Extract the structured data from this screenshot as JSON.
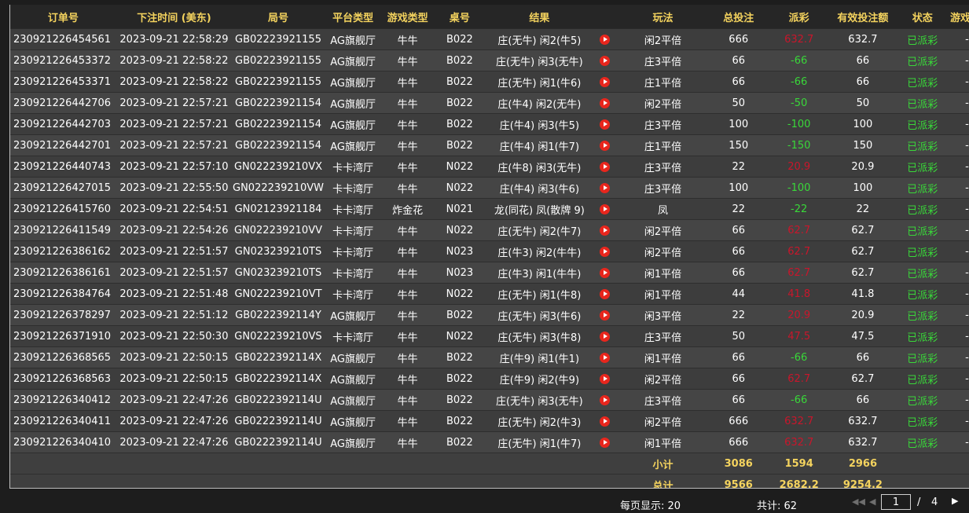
{
  "columns": [
    "订单号",
    "下注时间 (美东)",
    "局号",
    "平台类型",
    "游戏类型",
    "桌号",
    "结果",
    "",
    "玩法",
    "总投注",
    "派彩",
    "有效投注额",
    "状态",
    "游戏模式"
  ],
  "rows": [
    {
      "order": "230921226454561",
      "time": "2023-09-21 22:58:29",
      "round": "GB02223921155",
      "platform": "AG旗舰厅",
      "game": "牛牛",
      "table": "B022",
      "result": "庄(无牛) 闲2(牛5)",
      "play": "闲2平倍",
      "bet": "666",
      "payout": "632.7",
      "payout_type": "pos",
      "valid": "632.7",
      "status": "已派彩",
      "mode": "-"
    },
    {
      "order": "230921226453372",
      "time": "2023-09-21 22:58:22",
      "round": "GB02223921155",
      "platform": "AG旗舰厅",
      "game": "牛牛",
      "table": "B022",
      "result": "庄(无牛) 闲3(无牛)",
      "play": "庄3平倍",
      "bet": "66",
      "payout": "-66",
      "payout_type": "neg",
      "valid": "66",
      "status": "已派彩",
      "mode": "-"
    },
    {
      "order": "230921226453371",
      "time": "2023-09-21 22:58:22",
      "round": "GB02223921155",
      "platform": "AG旗舰厅",
      "game": "牛牛",
      "table": "B022",
      "result": "庄(无牛) 闲1(牛6)",
      "play": "庄1平倍",
      "bet": "66",
      "payout": "-66",
      "payout_type": "neg",
      "valid": "66",
      "status": "已派彩",
      "mode": "-"
    },
    {
      "order": "230921226442706",
      "time": "2023-09-21 22:57:21",
      "round": "GB02223921154",
      "platform": "AG旗舰厅",
      "game": "牛牛",
      "table": "B022",
      "result": "庄(牛4) 闲2(无牛)",
      "play": "闲2平倍",
      "bet": "50",
      "payout": "-50",
      "payout_type": "neg",
      "valid": "50",
      "status": "已派彩",
      "mode": "-"
    },
    {
      "order": "230921226442703",
      "time": "2023-09-21 22:57:21",
      "round": "GB02223921154",
      "platform": "AG旗舰厅",
      "game": "牛牛",
      "table": "B022",
      "result": "庄(牛4) 闲3(牛5)",
      "play": "庄3平倍",
      "bet": "100",
      "payout": "-100",
      "payout_type": "neg",
      "valid": "100",
      "status": "已派彩",
      "mode": "-"
    },
    {
      "order": "230921226442701",
      "time": "2023-09-21 22:57:21",
      "round": "GB02223921154",
      "platform": "AG旗舰厅",
      "game": "牛牛",
      "table": "B022",
      "result": "庄(牛4) 闲1(牛7)",
      "play": "庄1平倍",
      "bet": "150",
      "payout": "-150",
      "payout_type": "neg",
      "valid": "150",
      "status": "已派彩",
      "mode": "-"
    },
    {
      "order": "230921226440743",
      "time": "2023-09-21 22:57:10",
      "round": "GN022239210VX",
      "platform": "卡卡湾厅",
      "game": "牛牛",
      "table": "N022",
      "result": "庄(牛8) 闲3(无牛)",
      "play": "庄3平倍",
      "bet": "22",
      "payout": "20.9",
      "payout_type": "pos",
      "valid": "20.9",
      "status": "已派彩",
      "mode": "-"
    },
    {
      "order": "230921226427015",
      "time": "2023-09-21 22:55:50",
      "round": "GN022239210VW",
      "platform": "卡卡湾厅",
      "game": "牛牛",
      "table": "N022",
      "result": "庄(牛4) 闲3(牛6)",
      "play": "庄3平倍",
      "bet": "100",
      "payout": "-100",
      "payout_type": "neg",
      "valid": "100",
      "status": "已派彩",
      "mode": "-"
    },
    {
      "order": "230921226415760",
      "time": "2023-09-21 22:54:51",
      "round": "GN02123921184",
      "platform": "卡卡湾厅",
      "game": "炸金花",
      "table": "N021",
      "result": "龙(同花) 凤(散牌 9)",
      "play": "凤",
      "bet": "22",
      "payout": "-22",
      "payout_type": "neg",
      "valid": "22",
      "status": "已派彩",
      "mode": "-"
    },
    {
      "order": "230921226411549",
      "time": "2023-09-21 22:54:26",
      "round": "GN022239210VV",
      "platform": "卡卡湾厅",
      "game": "牛牛",
      "table": "N022",
      "result": "庄(无牛) 闲2(牛7)",
      "play": "闲2平倍",
      "bet": "66",
      "payout": "62.7",
      "payout_type": "pos",
      "valid": "62.7",
      "status": "已派彩",
      "mode": "-"
    },
    {
      "order": "230921226386162",
      "time": "2023-09-21 22:51:57",
      "round": "GN023239210TS",
      "platform": "卡卡湾厅",
      "game": "牛牛",
      "table": "N023",
      "result": "庄(牛3) 闲2(牛牛)",
      "play": "闲2平倍",
      "bet": "66",
      "payout": "62.7",
      "payout_type": "pos",
      "valid": "62.7",
      "status": "已派彩",
      "mode": "-"
    },
    {
      "order": "230921226386161",
      "time": "2023-09-21 22:51:57",
      "round": "GN023239210TS",
      "platform": "卡卡湾厅",
      "game": "牛牛",
      "table": "N023",
      "result": "庄(牛3) 闲1(牛牛)",
      "play": "闲1平倍",
      "bet": "66",
      "payout": "62.7",
      "payout_type": "pos",
      "valid": "62.7",
      "status": "已派彩",
      "mode": "-"
    },
    {
      "order": "230921226384764",
      "time": "2023-09-21 22:51:48",
      "round": "GN022239210VT",
      "platform": "卡卡湾厅",
      "game": "牛牛",
      "table": "N022",
      "result": "庄(无牛) 闲1(牛8)",
      "play": "闲1平倍",
      "bet": "44",
      "payout": "41.8",
      "payout_type": "pos",
      "valid": "41.8",
      "status": "已派彩",
      "mode": "-"
    },
    {
      "order": "230921226378297",
      "time": "2023-09-21 22:51:12",
      "round": "GB0222392114Y",
      "platform": "AG旗舰厅",
      "game": "牛牛",
      "table": "B022",
      "result": "庄(无牛) 闲3(牛6)",
      "play": "闲3平倍",
      "bet": "22",
      "payout": "20.9",
      "payout_type": "pos",
      "valid": "20.9",
      "status": "已派彩",
      "mode": "-"
    },
    {
      "order": "230921226371910",
      "time": "2023-09-21 22:50:30",
      "round": "GN022239210VS",
      "platform": "卡卡湾厅",
      "game": "牛牛",
      "table": "N022",
      "result": "庄(无牛) 闲3(牛8)",
      "play": "庄3平倍",
      "bet": "50",
      "payout": "47.5",
      "payout_type": "pos",
      "valid": "47.5",
      "status": "已派彩",
      "mode": "-"
    },
    {
      "order": "230921226368565",
      "time": "2023-09-21 22:50:15",
      "round": "GB0222392114X",
      "platform": "AG旗舰厅",
      "game": "牛牛",
      "table": "B022",
      "result": "庄(牛9) 闲1(牛1)",
      "play": "闲1平倍",
      "bet": "66",
      "payout": "-66",
      "payout_type": "neg",
      "valid": "66",
      "status": "已派彩",
      "mode": "-"
    },
    {
      "order": "230921226368563",
      "time": "2023-09-21 22:50:15",
      "round": "GB0222392114X",
      "platform": "AG旗舰厅",
      "game": "牛牛",
      "table": "B022",
      "result": "庄(牛9) 闲2(牛9)",
      "play": "闲2平倍",
      "bet": "66",
      "payout": "62.7",
      "payout_type": "pos",
      "valid": "62.7",
      "status": "已派彩",
      "mode": "-"
    },
    {
      "order": "230921226340412",
      "time": "2023-09-21 22:47:26",
      "round": "GB0222392114U",
      "platform": "AG旗舰厅",
      "game": "牛牛",
      "table": "B022",
      "result": "庄(无牛) 闲3(无牛)",
      "play": "庄3平倍",
      "bet": "66",
      "payout": "-66",
      "payout_type": "neg",
      "valid": "66",
      "status": "已派彩",
      "mode": "-"
    },
    {
      "order": "230921226340411",
      "time": "2023-09-21 22:47:26",
      "round": "GB0222392114U",
      "platform": "AG旗舰厅",
      "game": "牛牛",
      "table": "B022",
      "result": "庄(无牛) 闲2(牛3)",
      "play": "闲2平倍",
      "bet": "666",
      "payout": "632.7",
      "payout_type": "pos",
      "valid": "632.7",
      "status": "已派彩",
      "mode": "-"
    },
    {
      "order": "230921226340410",
      "time": "2023-09-21 22:47:26",
      "round": "GB0222392114U",
      "platform": "AG旗舰厅",
      "game": "牛牛",
      "table": "B022",
      "result": "庄(无牛) 闲1(牛7)",
      "play": "闲1平倍",
      "bet": "666",
      "payout": "632.7",
      "payout_type": "pos",
      "valid": "632.7",
      "status": "已派彩",
      "mode": "-"
    }
  ],
  "subtotal": {
    "label": "小计",
    "bet": "3086",
    "payout": "1594",
    "valid": "2966"
  },
  "total": {
    "label": "总计",
    "bet": "9566",
    "payout": "2682.2",
    "valid": "9254.2"
  },
  "footer": {
    "page_size_label": "每页显示: 20",
    "total_count_label": "共计: 62",
    "current_page": "1",
    "page_separator": "/",
    "total_pages": "4"
  },
  "colors": {
    "header_text": "#f4d35e",
    "positive_payout": "#c9162b",
    "negative_payout": "#39d839",
    "status": "#39d839",
    "play_icon": "#e8261d"
  }
}
